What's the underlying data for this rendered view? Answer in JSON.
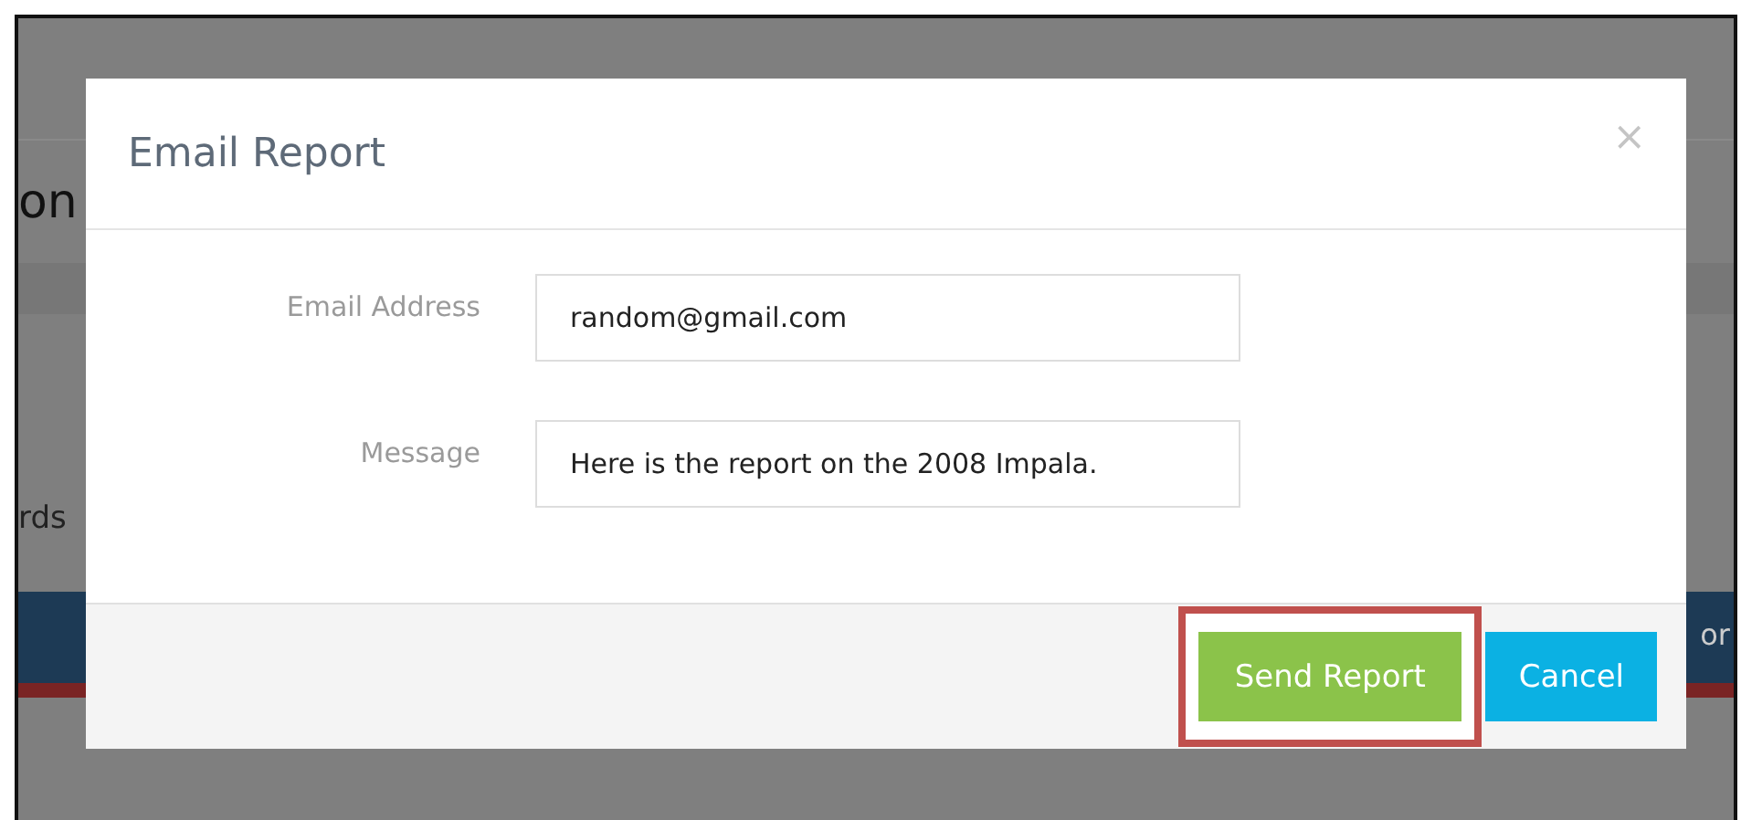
{
  "background": {
    "heading_fragment": "on",
    "text_fragment": "rds",
    "header_fragment": "or"
  },
  "dialog": {
    "title": "Email Report",
    "close": "×",
    "fields": [
      {
        "label": "Email Address",
        "value": "random@gmail.com"
      },
      {
        "label": "Message",
        "value": "Here is the report on the 2008 Impala."
      }
    ],
    "buttons": [
      {
        "label": "Send Report",
        "kind": "primary",
        "highlighted": true
      },
      {
        "label": "Cancel",
        "kind": "secondary",
        "highlighted": false
      }
    ]
  }
}
